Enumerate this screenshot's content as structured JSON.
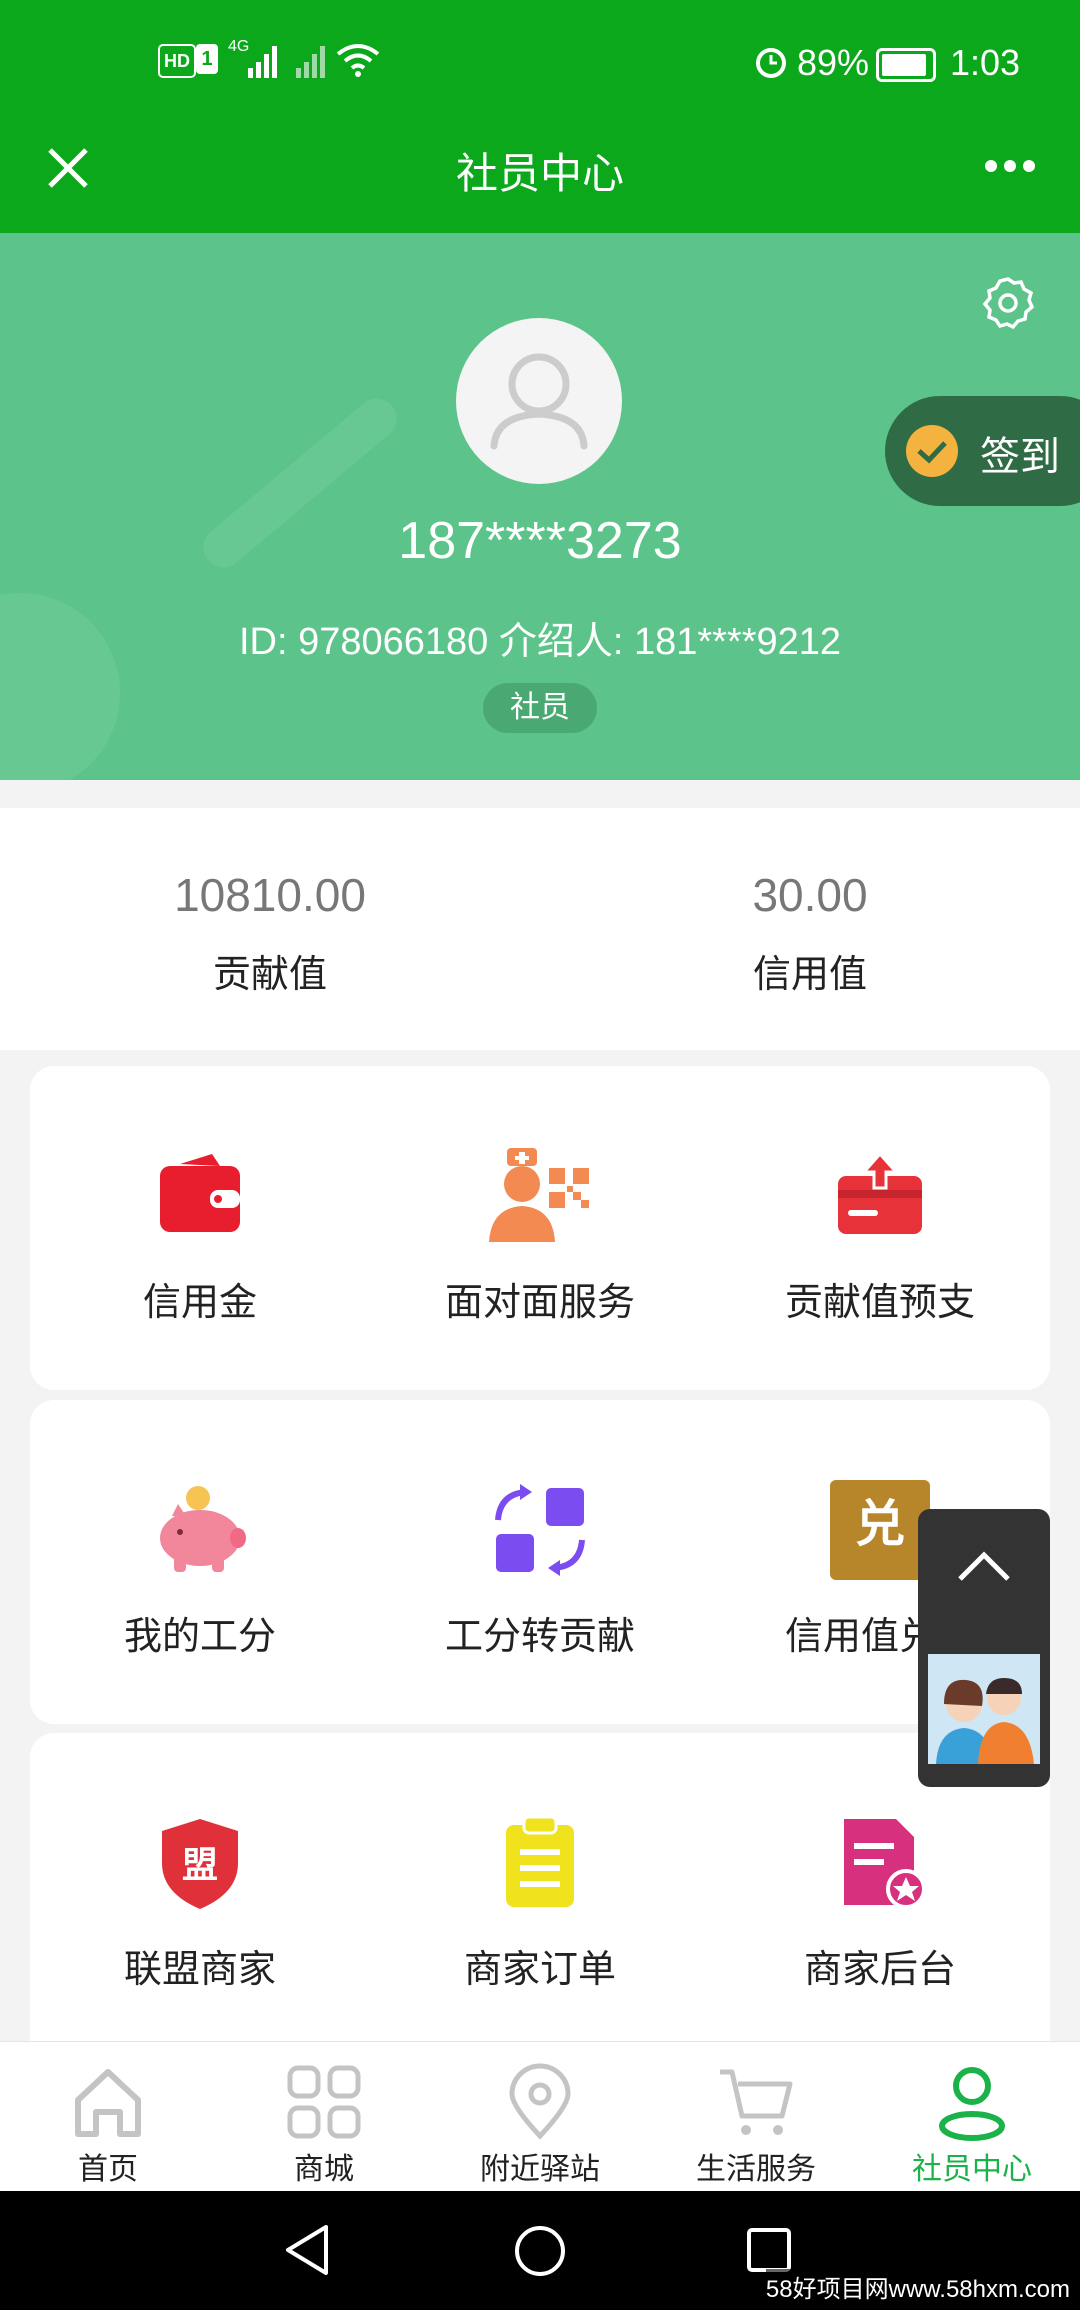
{
  "status_bar": {
    "time": "1:03",
    "battery": "89%",
    "network": "4G",
    "hd": "HD",
    "sim": "1"
  },
  "header": {
    "title": "社员中心"
  },
  "profile": {
    "phone": "187****3273",
    "id_line": "ID: 978066180   介绍人: 181****9212",
    "role": "社员",
    "checkin_label": "签到"
  },
  "stats": [
    {
      "value": "10810.00",
      "label": "贡献值"
    },
    {
      "value": "30.00",
      "label": "信用值"
    }
  ],
  "grid": {
    "row1": [
      {
        "label": "信用金",
        "icon": "wallet-icon"
      },
      {
        "label": "面对面服务",
        "icon": "face-to-face-service-icon"
      },
      {
        "label": "贡献值预支",
        "icon": "advance-card-icon"
      }
    ],
    "row2": [
      {
        "label": "我的工分",
        "icon": "piggy-bank-icon"
      },
      {
        "label": "工分转贡献",
        "icon": "convert-icon"
      },
      {
        "label": "信用值兑换",
        "icon": "exchange-icon"
      }
    ],
    "row3": [
      {
        "label": "联盟商家",
        "icon": "alliance-shield-icon"
      },
      {
        "label": "商家订单",
        "icon": "clipboard-icon"
      },
      {
        "label": "商家后台",
        "icon": "merchant-backend-icon"
      }
    ],
    "exchange_badge": "兑",
    "alliance_badge": "盟"
  },
  "tabs": [
    {
      "label": "首页",
      "icon": "home-icon"
    },
    {
      "label": "商城",
      "icon": "grid-icon"
    },
    {
      "label": "附近驿站",
      "icon": "location-icon"
    },
    {
      "label": "生活服务",
      "icon": "cart-icon"
    },
    {
      "label": "社员中心",
      "icon": "member-icon",
      "active": true
    }
  ],
  "watermark": "58好项目网www.58hxm.com",
  "colors": {
    "brand_green": "#0aa81a",
    "header_green": "#5cc48a",
    "active_tab": "#1bb24a"
  }
}
